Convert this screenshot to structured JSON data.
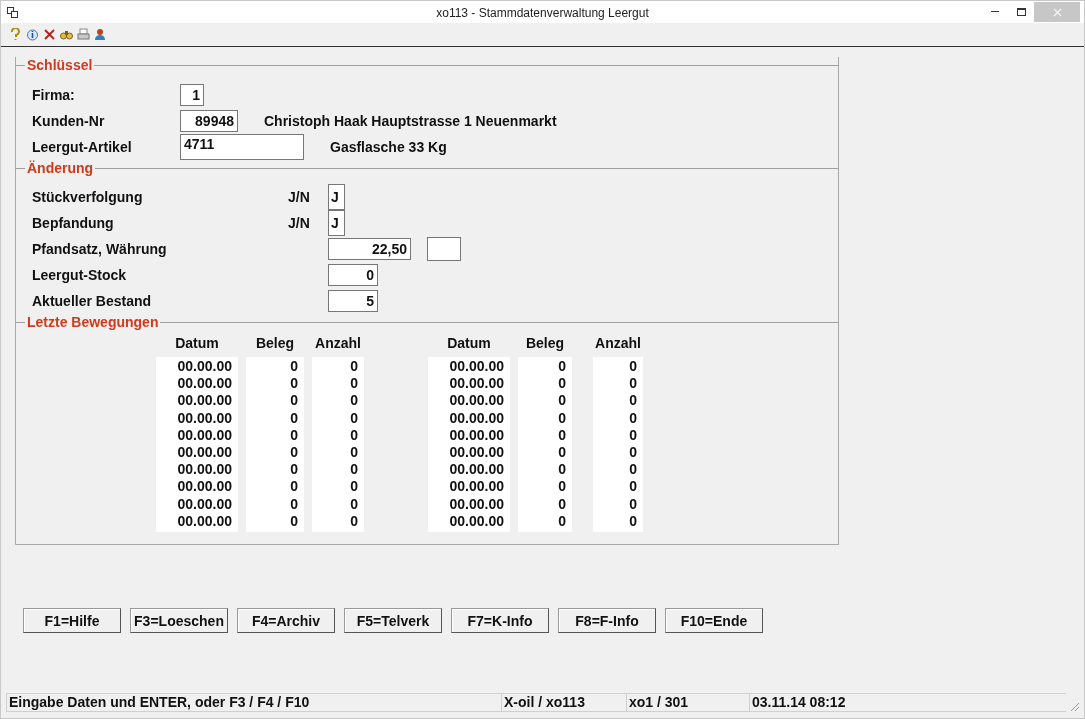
{
  "window": {
    "title": "xo113 - Stammdatenverwaltung Leergut"
  },
  "key": {
    "title": "Schlüssel",
    "rows": [
      {
        "label": "Firma:",
        "value": "1"
      },
      {
        "label": "Kunden-Nr",
        "value": "89948",
        "description": "Christoph Haak Hauptstrasse 1 Neuenmarkt"
      },
      {
        "label": "Leergut-Artikel",
        "value": "4711",
        "description": "Gasflasche 33 Kg"
      }
    ]
  },
  "changes": {
    "title": "Änderung",
    "rows": [
      {
        "label": "Stückverfolgung",
        "hint": "J/N",
        "value": "J"
      },
      {
        "label": "Bepfandung",
        "hint": "J/N",
        "value": "J"
      },
      {
        "label": "Pfandsatz, Währung",
        "value": "22,50",
        "currency_field": true
      },
      {
        "label": "Leergut-Stock",
        "value": "0"
      },
      {
        "label": "Aktueller Bestand",
        "value": "5"
      }
    ]
  },
  "movements": {
    "title": "Letzte Bewegungen",
    "groups": [
      {
        "columns": [
          "Datum",
          "Beleg",
          "Anzahl"
        ],
        "rows": [
          [
            "00.00.00",
            "0",
            "0"
          ],
          [
            "00.00.00",
            "0",
            "0"
          ],
          [
            "00.00.00",
            "0",
            "0"
          ],
          [
            "00.00.00",
            "0",
            "0"
          ],
          [
            "00.00.00",
            "0",
            "0"
          ],
          [
            "00.00.00",
            "0",
            "0"
          ],
          [
            "00.00.00",
            "0",
            "0"
          ],
          [
            "00.00.00",
            "0",
            "0"
          ],
          [
            "00.00.00",
            "0",
            "0"
          ],
          [
            "00.00.00",
            "0",
            "0"
          ]
        ]
      },
      {
        "columns": [
          "Datum",
          "Beleg",
          "Anzahl"
        ],
        "rows": [
          [
            "00.00.00",
            "0",
            "0"
          ],
          [
            "00.00.00",
            "0",
            "0"
          ],
          [
            "00.00.00",
            "0",
            "0"
          ],
          [
            "00.00.00",
            "0",
            "0"
          ],
          [
            "00.00.00",
            "0",
            "0"
          ],
          [
            "00.00.00",
            "0",
            "0"
          ],
          [
            "00.00.00",
            "0",
            "0"
          ],
          [
            "00.00.00",
            "0",
            "0"
          ],
          [
            "00.00.00",
            "0",
            "0"
          ],
          [
            "00.00.00",
            "0",
            "0"
          ]
        ]
      }
    ]
  },
  "buttons": [
    "F1=Hilfe",
    "F3=Loeschen",
    "F4=Archiv",
    "F5=Telverk",
    "F7=K-Info",
    "F8=F-Info",
    "F10=Ende"
  ],
  "status_bar": [
    "Eingabe Daten und ENTER, oder F3 / F4 / F10",
    "X-oil / xo113",
    "xo1 / 301",
    "03.11.14 08:12"
  ]
}
